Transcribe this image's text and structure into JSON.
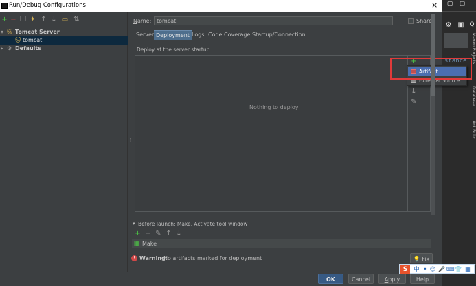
{
  "window": {
    "title": "Run/Debug Configurations",
    "close_glyph": "×"
  },
  "left_toolbar": {
    "icons": [
      "add-icon",
      "remove-icon",
      "copy-icon",
      "edit-defaults-icon",
      "move-up-icon",
      "move-down-icon",
      "folder-icon",
      "sort-icon"
    ]
  },
  "tree": {
    "tomcat_server": "Tomcat Server",
    "tomcat": "tomcat",
    "defaults": "Defaults"
  },
  "form": {
    "name_label": "Name:",
    "name_value": "tomcat",
    "share_label": "Share"
  },
  "tabs": [
    "Server",
    "Deployment",
    "Logs",
    "Code Coverage",
    "Startup/Connection"
  ],
  "active_tab": "Deployment",
  "deployment": {
    "heading": "Deploy at the server startup",
    "empty_text": "Nothing to deploy"
  },
  "add_menu": {
    "items": [
      "Artifact...",
      "External Source..."
    ],
    "selected": "Artifact..."
  },
  "before_launch": {
    "label": "Before launch: Make, Activate tool window",
    "task": "Make"
  },
  "warning": {
    "label": "Warning:",
    "text": "No artifacts marked for deployment",
    "fix_label": "Fix"
  },
  "buttons": {
    "ok": "OK",
    "cancel": "Cancel",
    "apply": "Apply",
    "help": "Help"
  },
  "background_ide": {
    "editor_text": "stance",
    "side_tabs": [
      "Maven Projects",
      "Database",
      "Ant Build"
    ]
  },
  "ime_bar": {
    "logo": "S",
    "lang": "中"
  },
  "colors": {
    "dialog_bg": "#3c3f41",
    "accent": "#4b6eaf",
    "highlight_border": "#e03a3a",
    "green": "#4ec946",
    "red": "#d84b4b"
  }
}
